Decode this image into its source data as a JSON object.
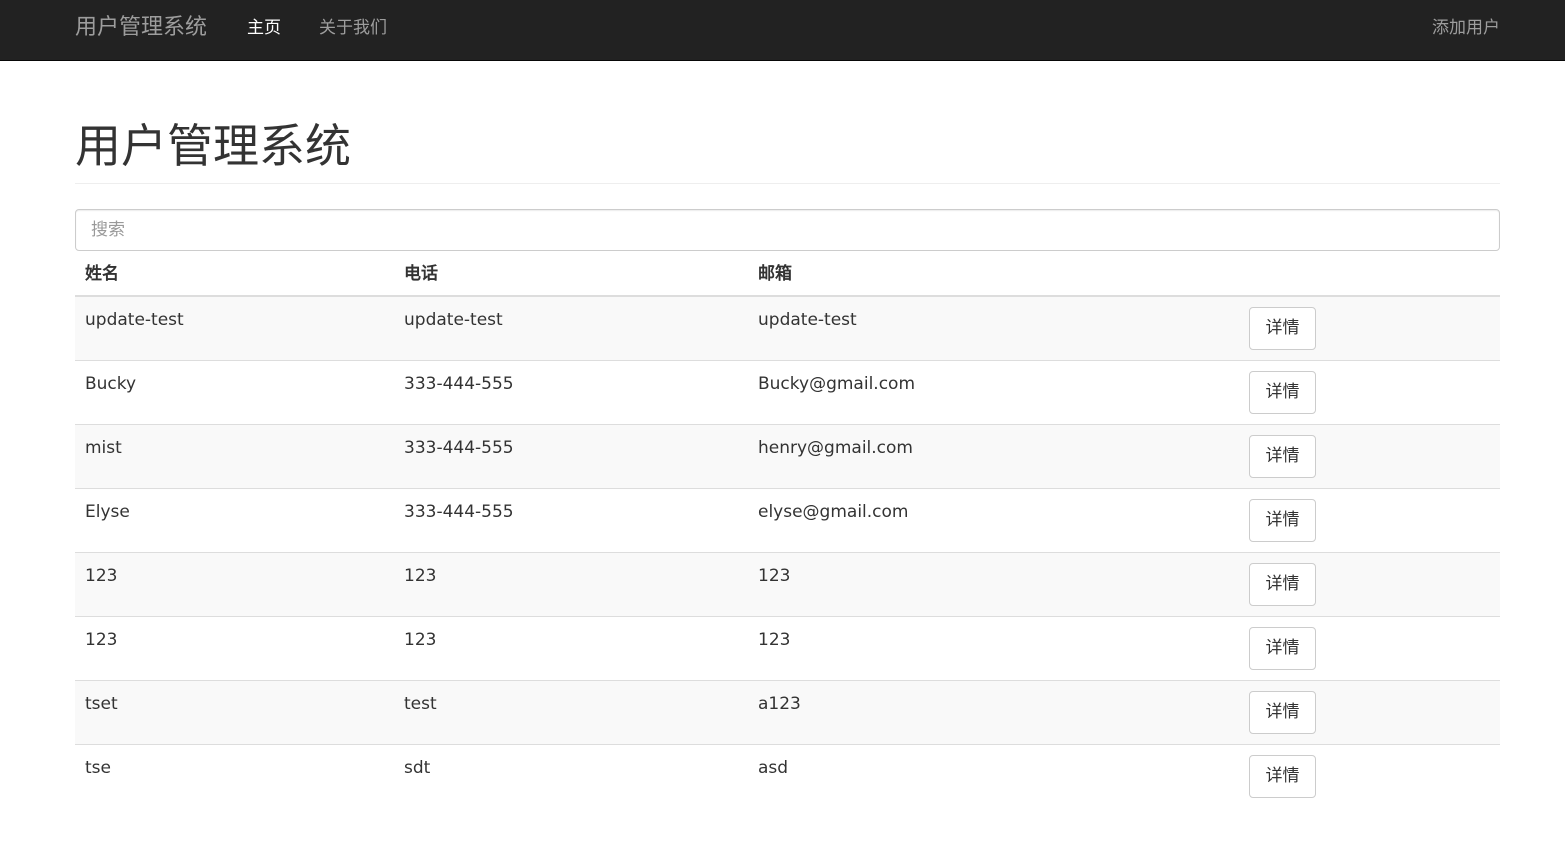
{
  "navbar": {
    "brand": "用户管理系统",
    "links": [
      {
        "label": "主页",
        "active": true
      },
      {
        "label": "关于我们",
        "active": false
      }
    ],
    "right_link": "添加用户",
    "background": "#222222"
  },
  "main": {
    "title": "用户管理系统",
    "search": {
      "placeholder": "搜索",
      "value": ""
    },
    "table": {
      "headers": [
        "姓名",
        "电话",
        "邮箱"
      ],
      "action_label": "详情",
      "rows": [
        {
          "name": "update-test",
          "phone": "update-test",
          "email": "update-test"
        },
        {
          "name": "Bucky",
          "phone": "333-444-555",
          "email": "Bucky@gmail.com"
        },
        {
          "name": "mist",
          "phone": "333-444-555",
          "email": "henry@gmail.com"
        },
        {
          "name": "Elyse",
          "phone": "333-444-555",
          "email": "elyse@gmail.com"
        },
        {
          "name": "123",
          "phone": "123",
          "email": "123"
        },
        {
          "name": "123",
          "phone": "123",
          "email": "123"
        },
        {
          "name": "tset",
          "phone": "test",
          "email": "a123"
        },
        {
          "name": "tse",
          "phone": "sdt",
          "email": "asd"
        }
      ]
    }
  }
}
